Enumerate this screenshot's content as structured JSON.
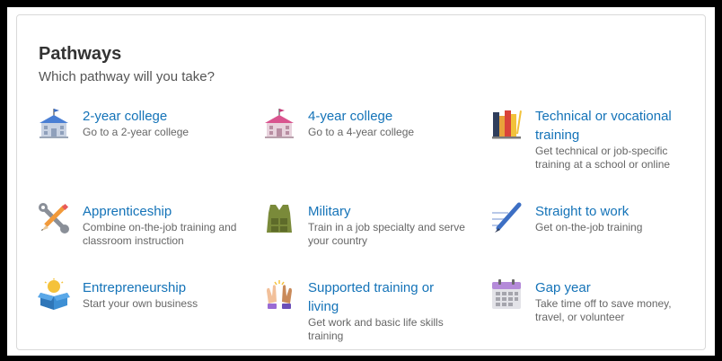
{
  "header": {
    "title": "Pathways",
    "subtitle": "Which pathway will you take?"
  },
  "pathways": [
    {
      "name": "2-year college",
      "description": "Go to a 2-year college",
      "icon": "school-building-blue-icon"
    },
    {
      "name": "4-year college",
      "description": "Go to a 4-year college",
      "icon": "school-building-pink-icon"
    },
    {
      "name": "Technical or vocational training",
      "description": "Get technical or job-specific training at a school or online",
      "icon": "books-pencil-icon"
    },
    {
      "name": "Apprenticeship",
      "description": "Combine on-the-job training and classroom instruction",
      "icon": "wrench-pencil-icon"
    },
    {
      "name": "Military",
      "description": "Train in a job specialty and serve your country",
      "icon": "military-vest-icon"
    },
    {
      "name": "Straight to work",
      "description": "Get on-the-job training",
      "icon": "pen-lines-icon"
    },
    {
      "name": "Entrepreneurship",
      "description": "Start your own business",
      "icon": "lightbulb-box-icon"
    },
    {
      "name": "Supported training or living",
      "description": "Get work and basic life skills training",
      "icon": "high-five-icon"
    },
    {
      "name": "Gap year",
      "description": "Take time off to save money, travel, or volunteer",
      "icon": "calendar-icon"
    }
  ],
  "colors": {
    "link": "#1473b8",
    "title": "#333333",
    "text": "#666666",
    "border": "#d9d9d9"
  }
}
